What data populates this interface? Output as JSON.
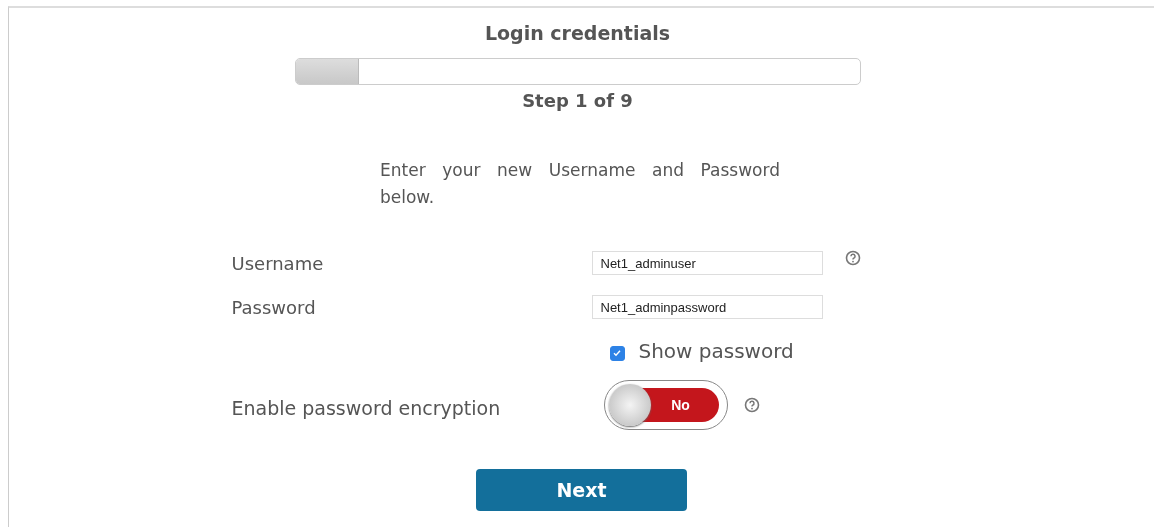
{
  "title": "Login credentials",
  "progress": {
    "level": 0.111
  },
  "step": "Step 1 of 9",
  "intro": "Enter your new Username and Password below.",
  "fields": [
    {
      "label": "Username",
      "value": "Net1_adminuser",
      "help": true
    },
    {
      "label": "Password",
      "value": "Net1_adminpassword",
      "help": false
    }
  ],
  "show_password": {
    "label": "Show password",
    "checked": true
  },
  "encryption": {
    "label": "Enable password encryption",
    "on": false,
    "state_text": "No"
  },
  "buttons": [
    {
      "label": "Next"
    }
  ]
}
